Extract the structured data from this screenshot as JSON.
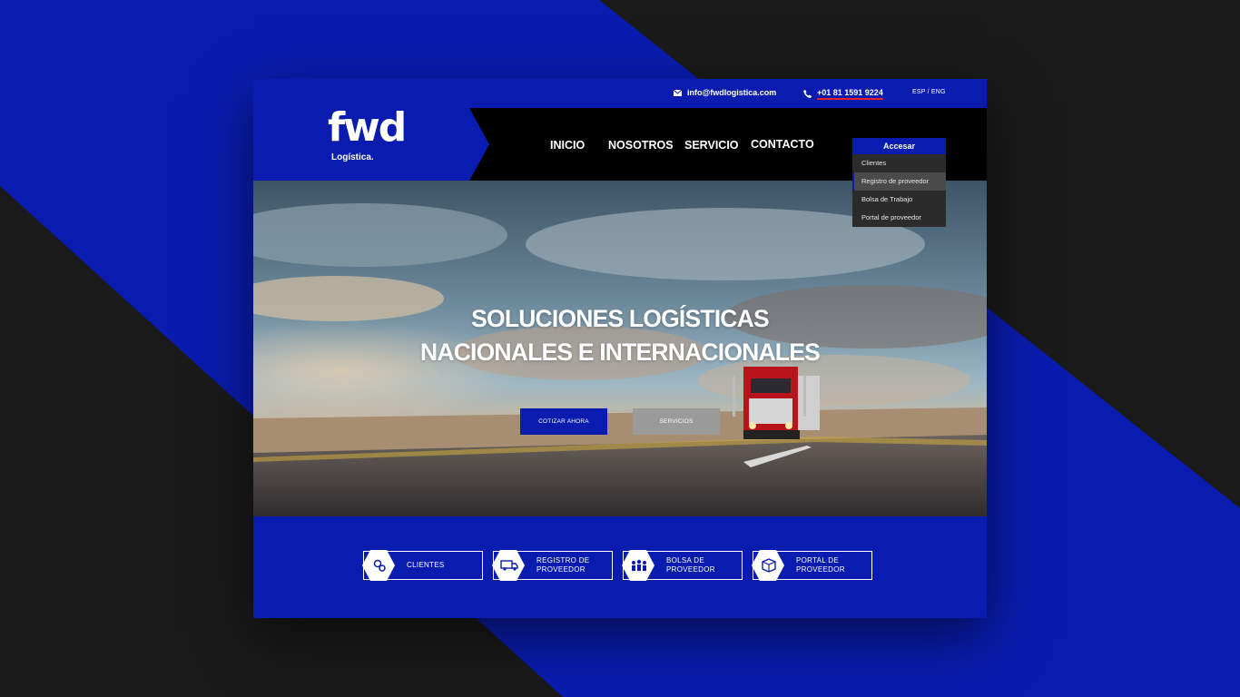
{
  "colors": {
    "brand_blue": "#0a1cb0",
    "header_black": "#000000",
    "bg_dark": "#1a1a1a",
    "accent_red": "#e2222b",
    "secondary_button": "#9a9a9a"
  },
  "topbar": {
    "email": "info@fwdlogistica.com",
    "email_icon": "envelope-icon",
    "phone": "+01 81 1591 9224",
    "phone_icon": "phone-icon",
    "language": "ESP / ENG"
  },
  "brand": {
    "logo": "fwd",
    "tagline": "Logística."
  },
  "nav": {
    "items": [
      {
        "label": "INICIO"
      },
      {
        "label": "NOSOTROS"
      },
      {
        "label": "SERVICIO"
      },
      {
        "label": "CONTACTO"
      }
    ]
  },
  "access_menu": {
    "label": "Accesar",
    "options": [
      {
        "label": "Clientes"
      },
      {
        "label": "Registro de proveedor"
      },
      {
        "label": "Bolsa de Trabajo"
      },
      {
        "label": "Portal de proveedor"
      }
    ]
  },
  "hero": {
    "title_line1": "SOLUCIONES LOGÍSTICAS",
    "title_line2": "NACIONALES E INTERNACIONALES",
    "primary_button": "COTIZAR AHORA",
    "secondary_button": "SERVICIOS"
  },
  "quick_links": [
    {
      "line1": "CLIENTES",
      "line2": "",
      "icon": "gears-icon"
    },
    {
      "line1": "REGISTRO DE",
      "line2": "PROVEEDOR",
      "icon": "truck-icon"
    },
    {
      "line1": "BOLSA DE",
      "line2": "PROVEEDOR",
      "icon": "people-icon"
    },
    {
      "line1": "PORTAL DE",
      "line2": "PROVEEDOR",
      "icon": "boxes-icon"
    }
  ]
}
